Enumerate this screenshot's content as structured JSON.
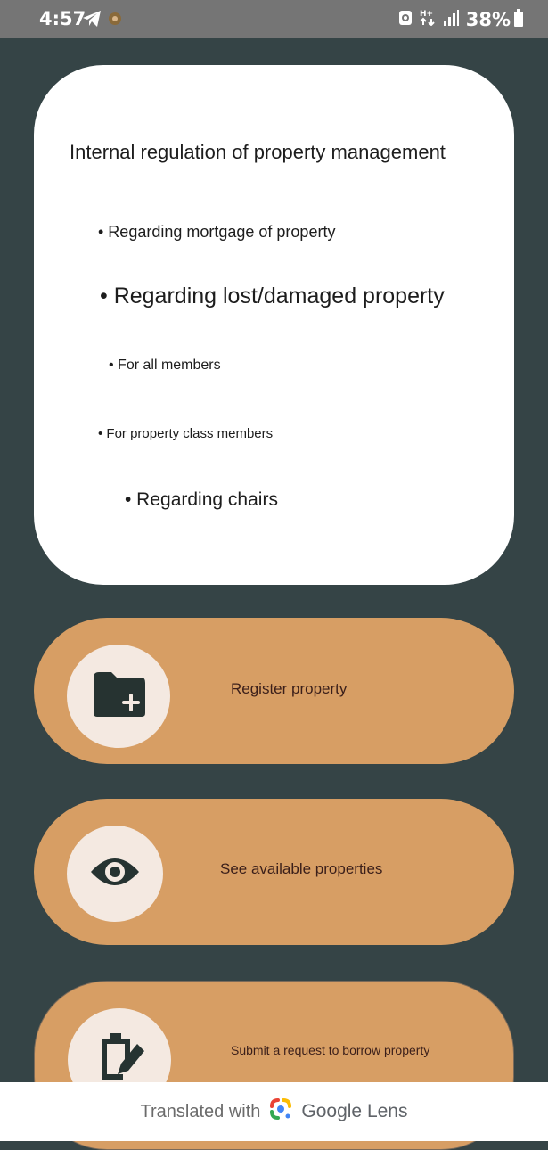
{
  "status_bar": {
    "time": "4:57",
    "battery": "38%",
    "icons": [
      "telegram-icon",
      "notification-icon",
      "alarm-icon",
      "data-icon",
      "signal-icon",
      "battery-icon"
    ]
  },
  "card": {
    "title": "Internal regulation of property management",
    "bullets": [
      "• Regarding mortgage of property",
      "• Regarding lost/damaged property",
      "• For all members",
      "• For property class members",
      "• Regarding chairs"
    ]
  },
  "actions": [
    {
      "label": "Register property",
      "icon": "folder-add-icon"
    },
    {
      "label": "See available properties",
      "icon": "eye-icon"
    },
    {
      "label": "Submit a request to borrow property",
      "icon": "edit-document-icon"
    }
  ],
  "footer": {
    "prefix": "Translated with",
    "brand": "Google Lens"
  },
  "colors": {
    "background": "#354446",
    "card": "#ffffff",
    "action": "#d79e64",
    "icon_circle": "#f4e9e1",
    "icon": "#263331"
  }
}
